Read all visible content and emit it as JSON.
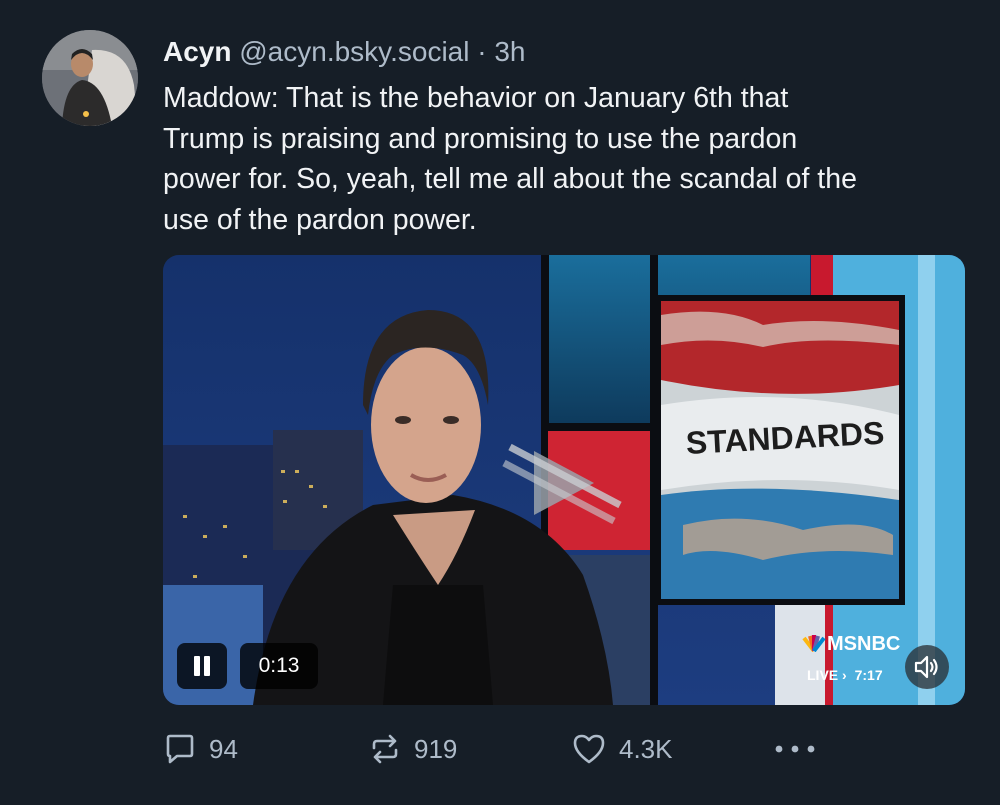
{
  "post": {
    "author_name": "Acyn",
    "handle": "@acyn.bsky.social",
    "separator": "·",
    "time": "3h",
    "text": "Maddow: That is the behavior on January 6th that\nTrump is praising and promising to use the pardon\npower for. So, yeah, tell me all about the scandal of the\nuse of the pardon power."
  },
  "video": {
    "graphic_text": "STANDARDS",
    "network": "MSNBC",
    "live_label": "LIVE",
    "live_arrow": "›",
    "live_time": "7:17",
    "elapsed": "0:13",
    "state": "playing",
    "controls": {
      "pause_icon": "pause-icon",
      "sound_icon": "speaker-icon",
      "play_overlay_icon": "play-icon"
    }
  },
  "actions": {
    "replies": "94",
    "reposts": "919",
    "likes": "4.3K",
    "more_icon": "more-dots-icon"
  },
  "colors": {
    "background": "#161e27",
    "text": "#f1f3f5",
    "muted": "#aebbc9"
  }
}
